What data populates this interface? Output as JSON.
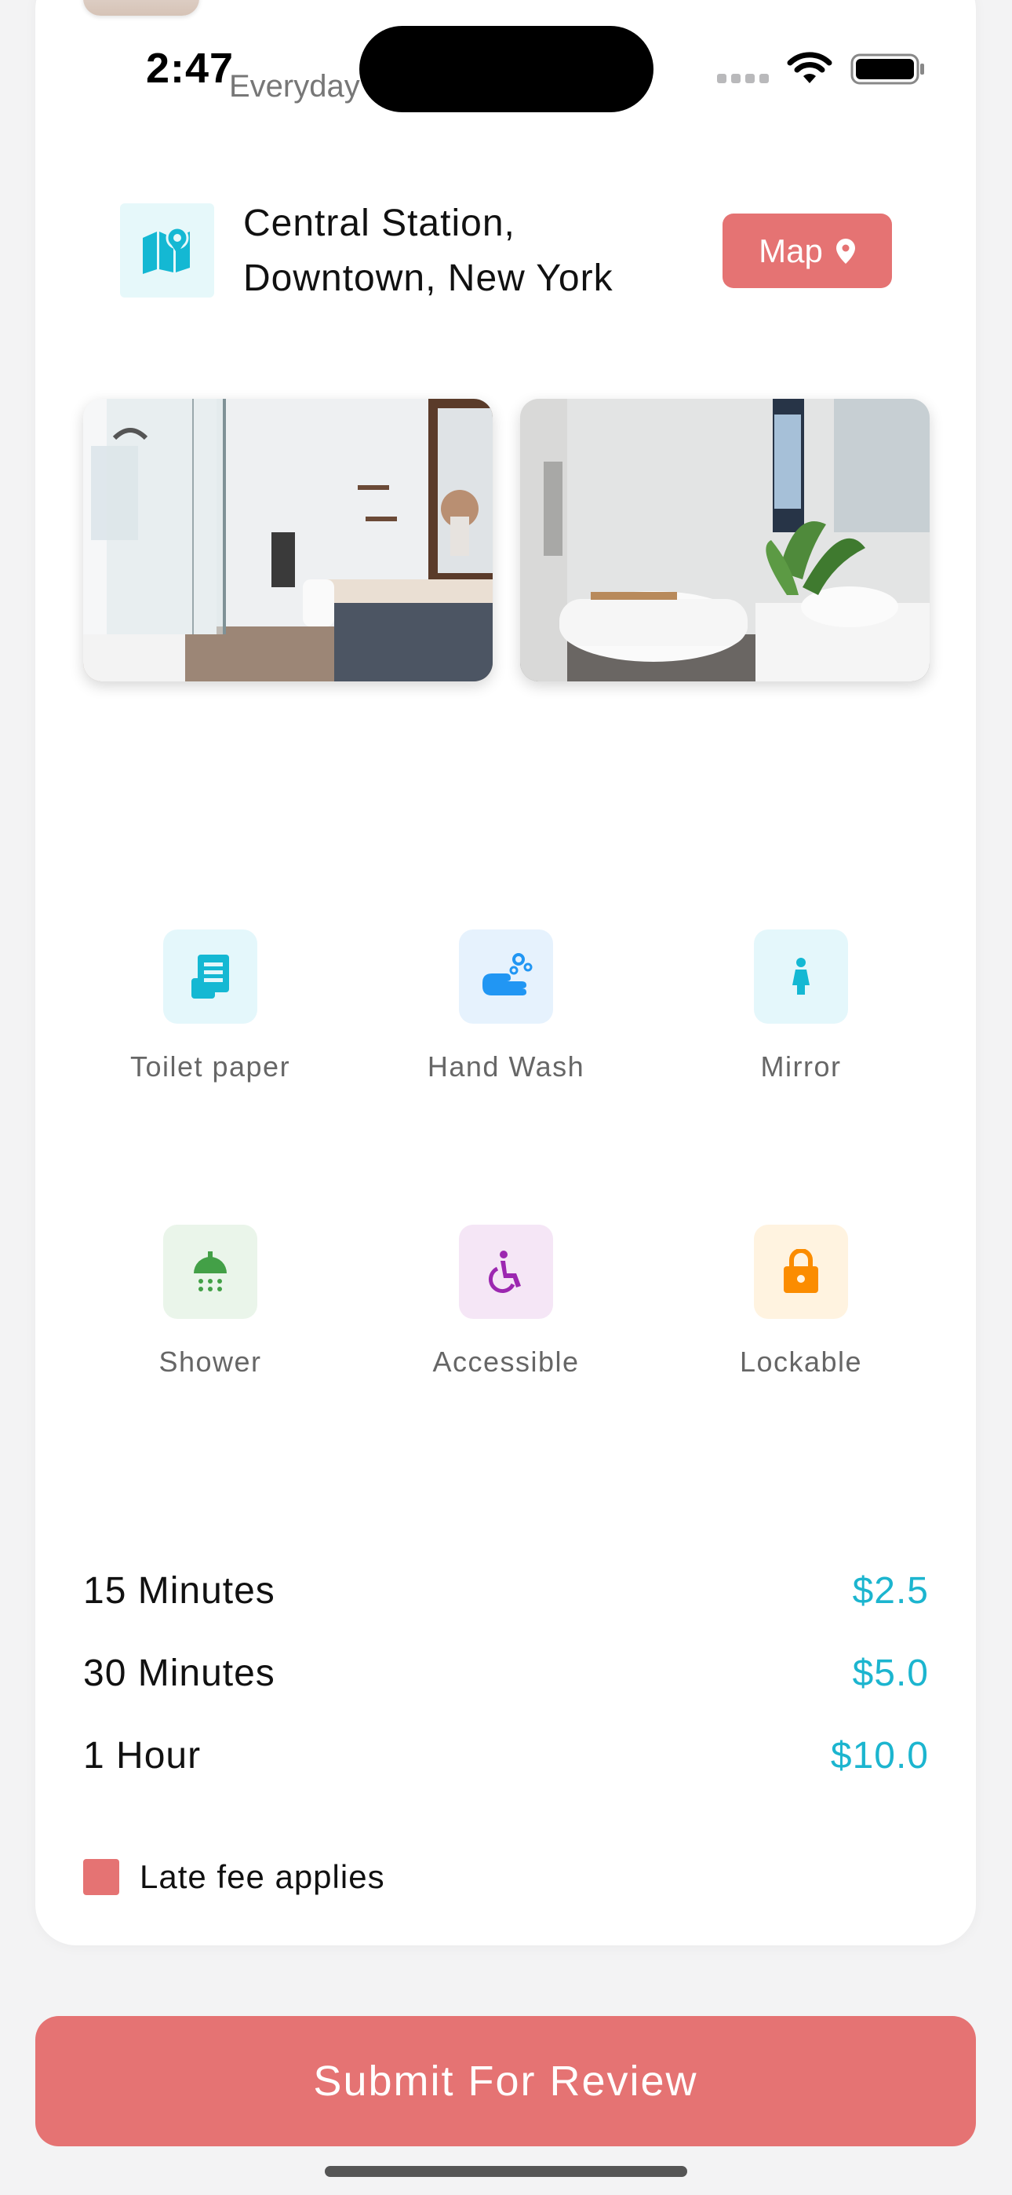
{
  "status_bar": {
    "time": "2:47",
    "partial_text": "Everyday",
    "wifi_icon": "wifi-icon",
    "battery_icon": "battery-icon"
  },
  "location": {
    "icon": "map-location-icon",
    "line1": "Central Station,",
    "line2": "Downtown, New York",
    "map_button_label": "Map",
    "map_button_icon": "location-pin-icon"
  },
  "photos": [
    {
      "name": "bathroom-photo-shower-vanity"
    },
    {
      "name": "bathroom-photo-bathtub-sink"
    }
  ],
  "amenities": [
    {
      "label": "Toilet paper",
      "icon": "toilet-paper-icon",
      "bg": "#e4f7fb",
      "color": "#14b8d3"
    },
    {
      "label": "Hand Wash",
      "icon": "hand-wash-icon",
      "bg": "#e6f2fd",
      "color": "#2196f3"
    },
    {
      "label": "Mirror",
      "icon": "person-icon",
      "bg": "#e4f7fb",
      "color": "#14b8d3"
    },
    {
      "label": "Shower",
      "icon": "shower-icon",
      "bg": "#eaf5ea",
      "color": "#43a047"
    },
    {
      "label": "Accessible",
      "icon": "wheelchair-icon",
      "bg": "#f5e6f6",
      "color": "#9c27b0"
    },
    {
      "label": "Lockable",
      "icon": "lock-icon",
      "bg": "#fff3e0",
      "color": "#fb8c00"
    }
  ],
  "pricing": [
    {
      "duration": "15 Minutes",
      "price": "$2.5"
    },
    {
      "duration": "30 Minutes",
      "price": "$5.0"
    },
    {
      "duration": "1 Hour",
      "price": "$10.0"
    }
  ],
  "late_fee_label": "Late fee applies",
  "submit_label": "Submit For Review",
  "colors": {
    "accent": "#e57373",
    "price": "#1cb5cf"
  }
}
